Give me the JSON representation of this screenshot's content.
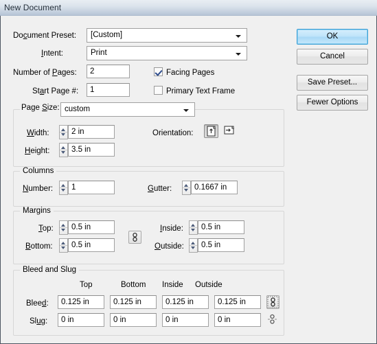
{
  "window": {
    "title": "New Document"
  },
  "buttons": {
    "ok": "OK",
    "cancel": "Cancel",
    "save_preset": "Save Preset...",
    "fewer_options": "Fewer Options"
  },
  "top": {
    "document_preset_label": "Document Preset:",
    "document_preset_value": "[Custom]",
    "intent_label": "Intent:",
    "intent_value": "Print",
    "number_of_pages_label": "Number of Pages:",
    "number_of_pages_value": "2",
    "start_page_label": "Start Page #:",
    "start_page_value": "1",
    "facing_pages_label": "Facing Pages",
    "facing_pages_checked": true,
    "primary_text_frame_label": "Primary Text Frame",
    "primary_text_frame_checked": false
  },
  "page_size": {
    "legend_label": "Page Size:",
    "value": "custom",
    "width_label": "Width:",
    "width_value": "2 in",
    "height_label": "Height:",
    "height_value": "3.5 in",
    "orientation_label": "Orientation:",
    "orientation_portrait_icon": "portrait-orientation-icon",
    "orientation_landscape_icon": "landscape-orientation-icon",
    "orientation_selected": "portrait"
  },
  "columns": {
    "legend": "Columns",
    "number_label": "Number:",
    "number_value": "1",
    "gutter_label": "Gutter:",
    "gutter_value": "0.1667 in"
  },
  "margins": {
    "legend": "Margins",
    "top_label": "Top:",
    "top_value": "0.5 in",
    "bottom_label": "Bottom:",
    "bottom_value": "0.5 in",
    "inside_label": "Inside:",
    "inside_value": "0.5 in",
    "outside_label": "Outside:",
    "outside_value": "0.5 in",
    "link_icon": "chain-link-icon"
  },
  "bleed_and_slug": {
    "legend": "Bleed and Slug",
    "col_top": "Top",
    "col_bottom": "Bottom",
    "col_inside": "Inside",
    "col_outside": "Outside",
    "bleed_label": "Bleed:",
    "bleed_top": "0.125 in",
    "bleed_bottom": "0.125 in",
    "bleed_inside": "0.125 in",
    "bleed_outside": "0.125 in",
    "bleed_link_icon": "chain-link-icon",
    "slug_label": "Slug:",
    "slug_top": "0 in",
    "slug_bottom": "0 in",
    "slug_inside": "0 in",
    "slug_outside": "0 in",
    "slug_link_icon": "chain-link-broken-icon"
  },
  "colors": {
    "dialog_bg": "#f0f0f0",
    "titlebar_top": "#e9eef3",
    "titlebar_bottom": "#9badc2",
    "default_button_accent": "#3c9fd6",
    "checkmark": "#2b4a8b"
  }
}
